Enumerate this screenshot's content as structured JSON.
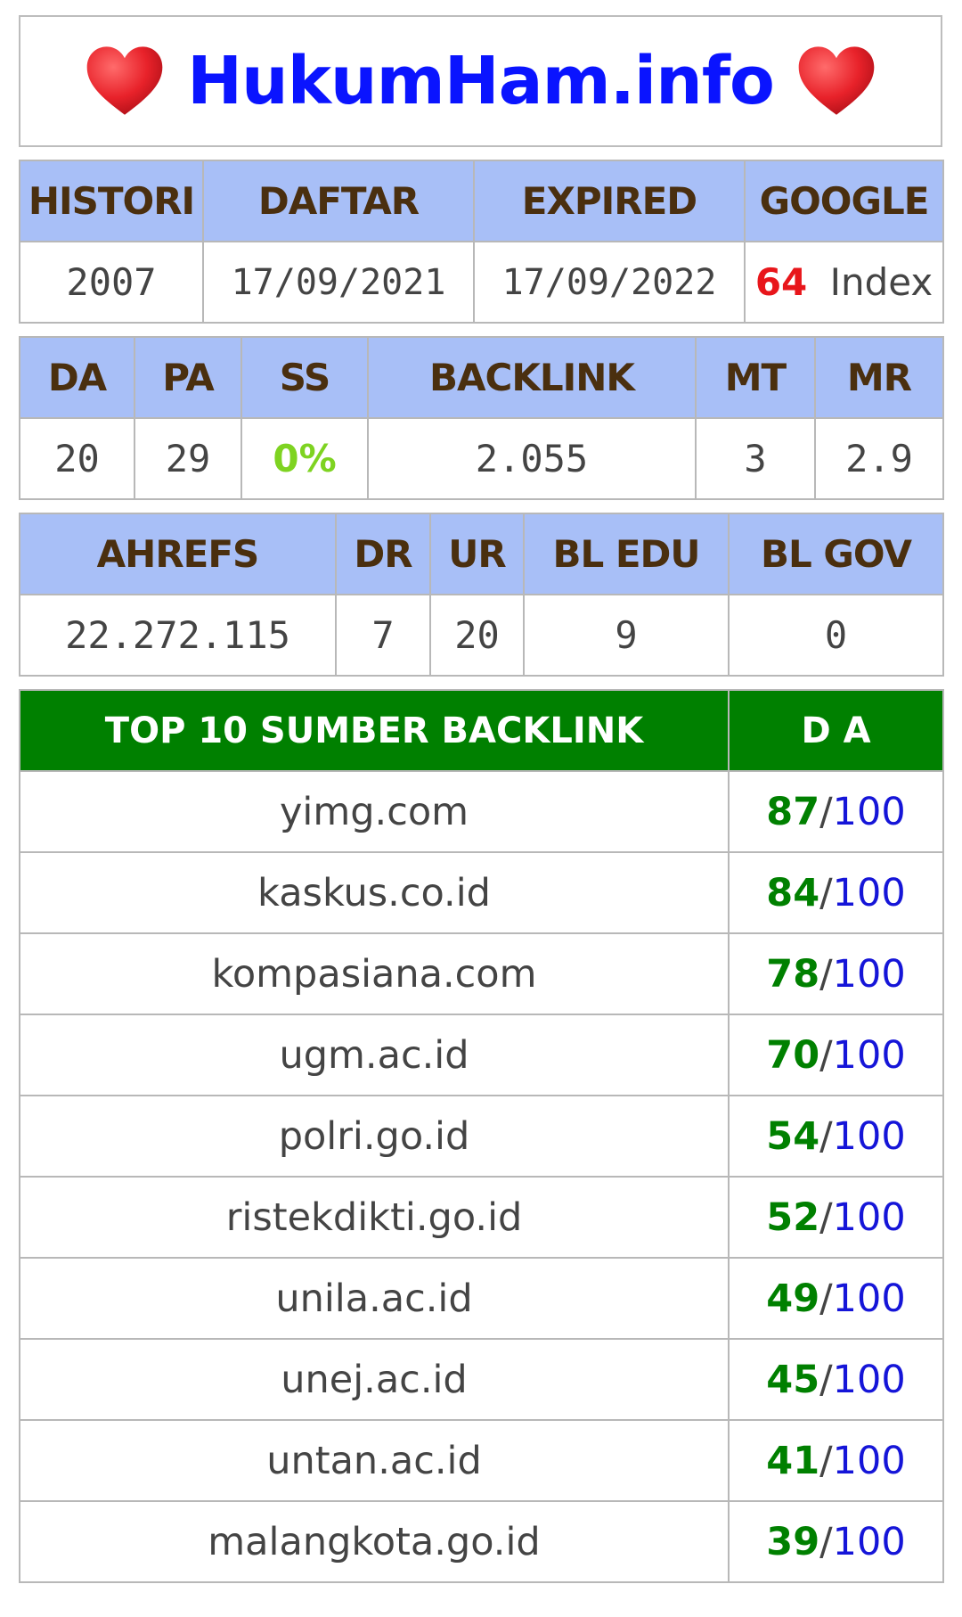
{
  "site_title": "HukumHam.info",
  "info_table": {
    "headers": [
      "HISTORI",
      "DAFTAR",
      "EXPIRED",
      "GOOGLE"
    ],
    "values": {
      "histori": "2007",
      "daftar": "17/09/2021",
      "expired": "17/09/2022",
      "google_count": "64",
      "google_suffix": "Index"
    }
  },
  "metrics_table": {
    "headers": [
      "DA",
      "PA",
      "SS",
      "BACKLINK",
      "MT",
      "MR"
    ],
    "values": [
      "20",
      "29",
      "0%",
      "2.055",
      "3",
      "2.9"
    ]
  },
  "ahrefs_table": {
    "headers": [
      "AHREFS",
      "DR",
      "UR",
      "BL EDU",
      "BL GOV"
    ],
    "values": [
      "22.272.115",
      "7",
      "20",
      "9",
      "0"
    ]
  },
  "backlinks": {
    "header_source": "TOP 10 SUMBER BACKLINK",
    "header_da": "D A",
    "max": "100",
    "rows": [
      {
        "site": "yimg.com",
        "da": "87"
      },
      {
        "site": "kaskus.co.id",
        "da": "84"
      },
      {
        "site": "kompasiana.com",
        "da": "78"
      },
      {
        "site": "ugm.ac.id",
        "da": "70"
      },
      {
        "site": "polri.go.id",
        "da": "54"
      },
      {
        "site": "ristekdikti.go.id",
        "da": "52"
      },
      {
        "site": "unila.ac.id",
        "da": "49"
      },
      {
        "site": "unej.ac.id",
        "da": "45"
      },
      {
        "site": "untan.ac.id",
        "da": "41"
      },
      {
        "site": "malangkota.go.id",
        "da": "39"
      }
    ]
  },
  "icons": {
    "left": "heart-icon",
    "right": "heart-icon"
  },
  "colors": {
    "title": "#0a14ff",
    "header_bg": "#a8bff7",
    "header_text": "#4a2f0f",
    "green_header": "#008000",
    "google_count": "#e8161b",
    "ss_value": "#7ed321",
    "score_max": "#1515d8"
  }
}
